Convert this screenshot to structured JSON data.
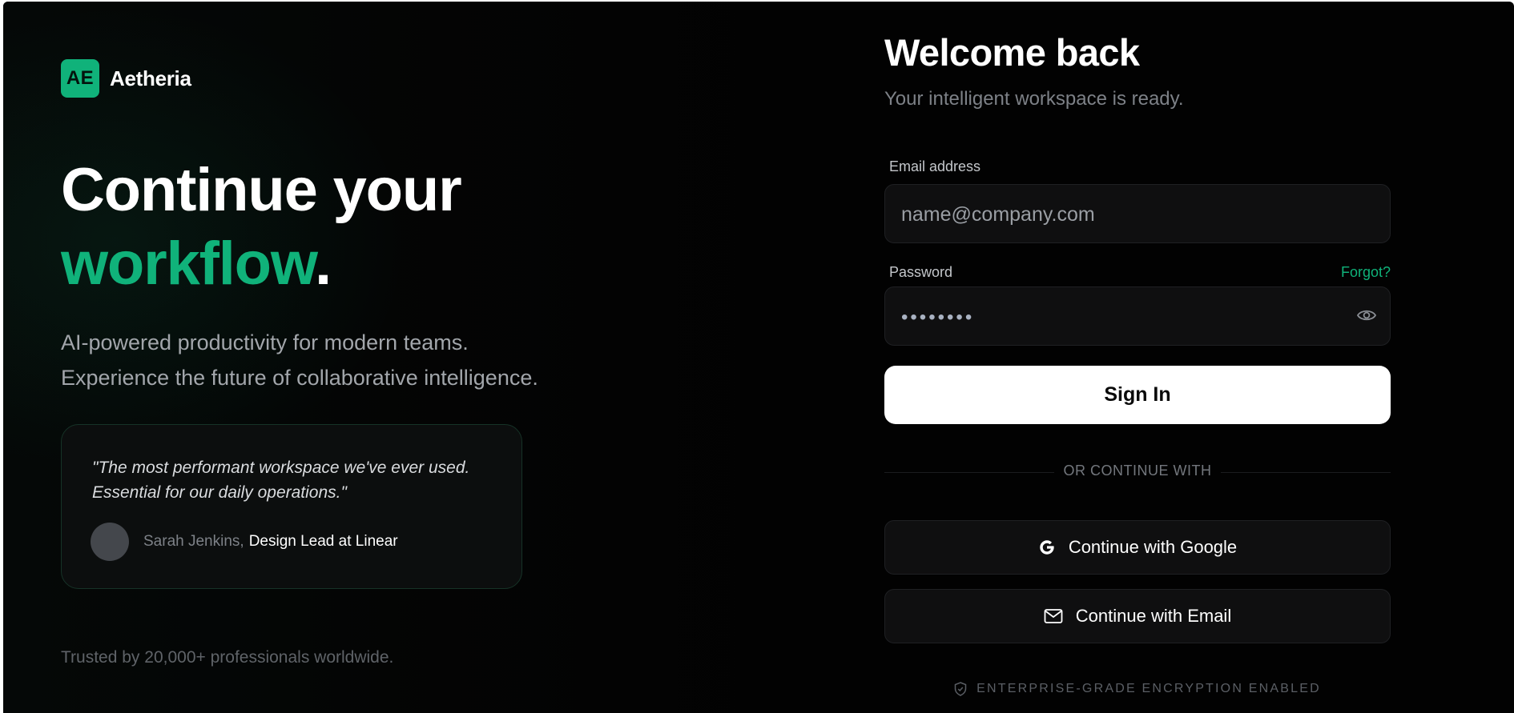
{
  "brand": {
    "badge": "AE",
    "name": "Aetheria"
  },
  "hero": {
    "line1": "Continue your",
    "line2_accent": "workflow",
    "line2_end": ".",
    "sub1": "AI-powered productivity for modern teams.",
    "sub2": "Experience the future of collaborative intelligence."
  },
  "testimonial": {
    "quote": "\"The most performant workspace we've ever used. Essential for our daily operations.\"",
    "author_name": "Sarah Jenkins,",
    "author_role": "Design Lead at Linear"
  },
  "trusted": "Trusted by 20,000+ professionals worldwide.",
  "form": {
    "title": "Welcome back",
    "subtitle": "Your intelligent workspace is ready.",
    "email_label": "Email address",
    "email_placeholder": "name@company.com",
    "password_label": "Password",
    "password_mask": "••••••••",
    "forgot_label": "Forgot?",
    "signin_label": "Sign In",
    "divider_text": "OR CONTINUE WITH",
    "google_label": "Continue with Google",
    "email_button_label": "Continue with Email",
    "security_note": "ENTERPRISE-GRADE ENCRYPTION ENABLED"
  },
  "colors": {
    "accent": "#10b27a",
    "background": "#020202",
    "card": "#0f0f10"
  },
  "icons": {
    "password_toggle": "eye-icon",
    "google": "google-icon",
    "email": "mail-icon",
    "security": "shield-icon"
  }
}
